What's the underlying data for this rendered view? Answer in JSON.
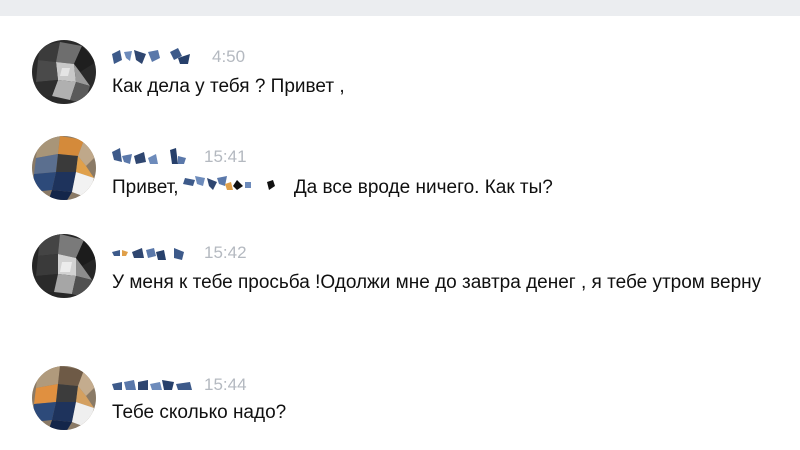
{
  "messages": [
    {
      "author": "redacted",
      "time": "4:50",
      "text": "Как дела у тебя ? Привет ,"
    },
    {
      "author": "redacted",
      "time": "15:41",
      "text_before": "Привет,",
      "text_after": "Да все вроде ничего. Как ты?"
    },
    {
      "author": "redacted",
      "time": "15:42",
      "text": "У меня к тебе просьба !Одолжи мне до завтра денег , я тебе утром верну"
    },
    {
      "author": "redacted",
      "time": "15:44",
      "text": "Тебе сколько надо?"
    }
  ],
  "colors": {
    "top_bar": "#ebedf0",
    "time": "#b4b9c0",
    "text": "#101010",
    "redaction_blue": "#3d5a8a"
  }
}
